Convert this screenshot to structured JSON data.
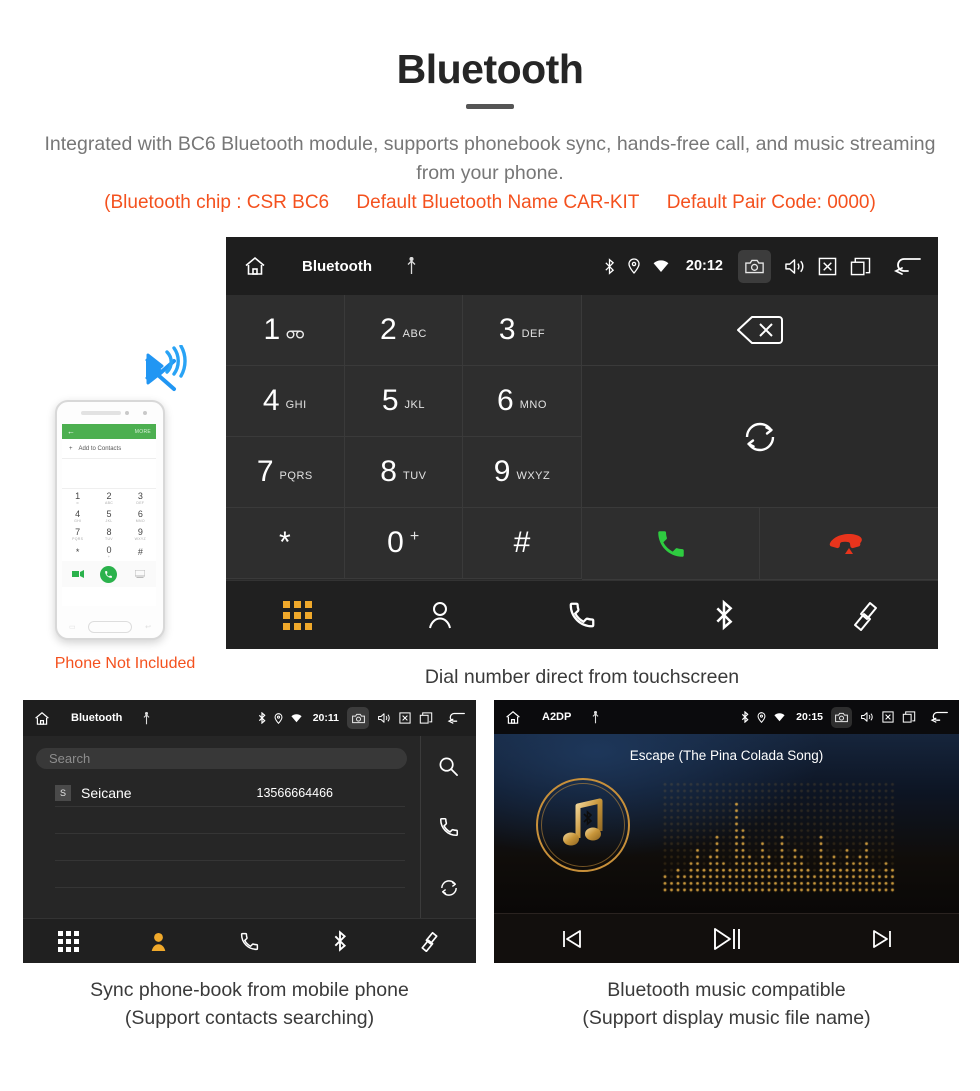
{
  "header": {
    "title": "Bluetooth",
    "description": "Integrated with BC6 Bluetooth module, supports phonebook sync, hands-free call, and music streaming from your phone.",
    "note_chip": "(Bluetooth chip : CSR BC6",
    "note_name": "Default Bluetooth Name CAR-KIT",
    "note_pair": "Default Pair Code: 0000)",
    "accent_color": "#f4511e",
    "title_color": "#262626",
    "description_color": "#777777"
  },
  "dialer": {
    "statusbar": {
      "home_icon": "home-icon",
      "title": "Bluetooth",
      "usb_icon": "usb-icon",
      "bluetooth_icon": "bluetooth-icon",
      "location_icon": "location-icon",
      "wifi_icon": "wifi-icon",
      "clock": "20:12",
      "camera_icon": "camera-icon",
      "volume_icon": "volume-icon",
      "close_icon": "close-box-icon",
      "recents_icon": "recent-apps-icon",
      "back_icon": "back-arrow-icon"
    },
    "keys": [
      {
        "digit": "1",
        "sub": "",
        "sub_icon": "voicemail-icon"
      },
      {
        "digit": "2",
        "sub": "ABC",
        "sub_icon": ""
      },
      {
        "digit": "3",
        "sub": "DEF",
        "sub_icon": ""
      },
      {
        "digit": "4",
        "sub": "GHI",
        "sub_icon": ""
      },
      {
        "digit": "5",
        "sub": "JKL",
        "sub_icon": ""
      },
      {
        "digit": "6",
        "sub": "MNO",
        "sub_icon": ""
      },
      {
        "digit": "7",
        "sub": "PQRS",
        "sub_icon": ""
      },
      {
        "digit": "8",
        "sub": "TUV",
        "sub_icon": ""
      },
      {
        "digit": "9",
        "sub": "WXYZ",
        "sub_icon": ""
      },
      {
        "digit": "*",
        "sub": "",
        "sub_icon": ""
      },
      {
        "digit": "0",
        "sub": "+",
        "sub_icon": ""
      },
      {
        "digit": "#",
        "sub": "",
        "sub_icon": ""
      }
    ],
    "backspace_icon": "backspace-icon",
    "sync_icon": "sync-icon",
    "call_icon": "call-answer-icon",
    "hangup_icon": "call-end-icon",
    "call_color": "#2ecc40",
    "hangup_color": "#e8341c",
    "navbar": {
      "keypad_label": "keypad-icon",
      "contacts_label": "contacts-icon",
      "calls_label": "call-history-icon",
      "bluetooth_label": "bluetooth-icon",
      "link_label": "link-icon",
      "active": "keypad",
      "active_color": "#f0a92b"
    },
    "caption": "Dial number direct from touchscreen"
  },
  "phone_mock": {
    "app_bar_back": "←",
    "app_bar_more": "MORE",
    "add_contacts": "Add to Contacts",
    "add_icon": "plus-icon",
    "keys": [
      {
        "digit": "1",
        "sub": "∞"
      },
      {
        "digit": "2",
        "sub": "ABC"
      },
      {
        "digit": "3",
        "sub": "DEF"
      },
      {
        "digit": "4",
        "sub": "GHI"
      },
      {
        "digit": "5",
        "sub": "JKL"
      },
      {
        "digit": "6",
        "sub": "MNO"
      },
      {
        "digit": "7",
        "sub": "PQRS"
      },
      {
        "digit": "8",
        "sub": "TUV"
      },
      {
        "digit": "9",
        "sub": "WXYZ"
      },
      {
        "digit": "*",
        "sub": ""
      },
      {
        "digit": "0",
        "sub": "+"
      },
      {
        "digit": "#",
        "sub": ""
      }
    ],
    "video_icon": "video-call-icon",
    "call_icon": "call-answer-icon",
    "keyboard_icon": "keyboard-icon",
    "bluetooth_wave_icon": "bluetooth-signal-icon",
    "bluetooth_wave_color": "#2196f3",
    "not_included_label": "Phone Not Included"
  },
  "phonebook": {
    "statusbar": {
      "home_icon": "home-icon",
      "title": "Bluetooth",
      "usb_icon": "usb-icon",
      "clock": "20:11",
      "camera_icon": "camera-icon",
      "volume_icon": "volume-icon",
      "close_icon": "close-box-icon",
      "recents_icon": "recent-apps-icon",
      "back_icon": "back-arrow-icon"
    },
    "search_placeholder": "Search",
    "contacts": [
      {
        "initial": "S",
        "name": "Seicane",
        "number": "13566664466"
      }
    ],
    "sidebar": {
      "search_icon": "search-icon",
      "call_icon": "call-history-icon",
      "sync_icon": "sync-icon"
    },
    "navbar": {
      "keypad_label": "keypad-icon",
      "contacts_label": "contacts-icon",
      "calls_label": "call-history-icon",
      "bluetooth_label": "bluetooth-icon",
      "link_label": "link-icon",
      "active": "contacts",
      "active_color": "#f0a92b"
    },
    "caption_line1": "Sync phone-book from mobile phone",
    "caption_line2": "(Support contacts searching)"
  },
  "music": {
    "statusbar": {
      "home_icon": "home-icon",
      "title": "A2DP",
      "usb_icon": "usb-icon",
      "clock": "20:15",
      "camera_icon": "camera-icon",
      "volume_icon": "volume-icon",
      "close_icon": "close-box-icon",
      "recents_icon": "recent-apps-icon",
      "back_icon": "back-arrow-icon"
    },
    "track_title": "Escape (The Pina Colada Song)",
    "album_art_icon": "music-note-bluetooth-icon",
    "accent_color": "#d9a441",
    "controls": {
      "prev_icon": "skip-previous-icon",
      "play_pause_icon": "play-pause-icon",
      "next_icon": "skip-next-icon"
    },
    "caption_line1": "Bluetooth music compatible",
    "caption_line2": "(Support display music file name)"
  }
}
